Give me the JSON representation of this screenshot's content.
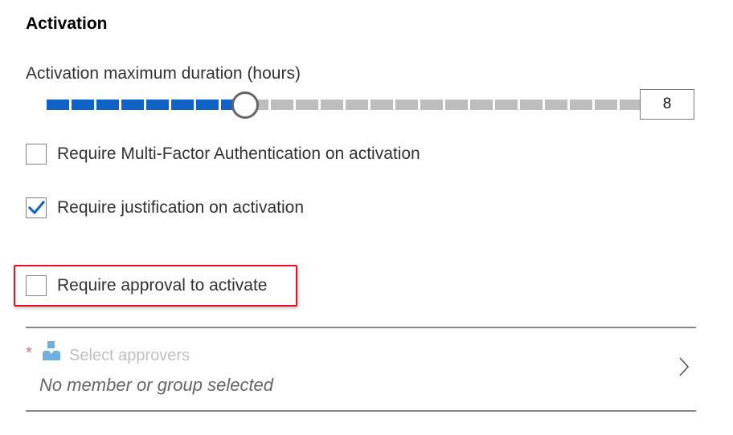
{
  "section": {
    "title": "Activation"
  },
  "duration": {
    "label": "Activation maximum duration (hours)",
    "value": "8",
    "min": 1,
    "max": 24,
    "filled_color": "#0f62c8",
    "empty_color": "#bdbdbd"
  },
  "checkboxes": {
    "mfa": {
      "label": "Require Multi-Factor Authentication on activation",
      "checked": false
    },
    "justification": {
      "label": "Require justification on activation",
      "checked": true
    },
    "approval": {
      "label": "Require approval to activate",
      "checked": false,
      "highlighted": true
    }
  },
  "approvers": {
    "required_marker": "*",
    "label": "Select approvers",
    "value": "No member or group selected",
    "icon": "person-icon",
    "chevron_icon": "chevron-right-icon"
  },
  "colors": {
    "accent": "#0f62c8",
    "highlight": "#e81123",
    "required": "#e8737b"
  }
}
